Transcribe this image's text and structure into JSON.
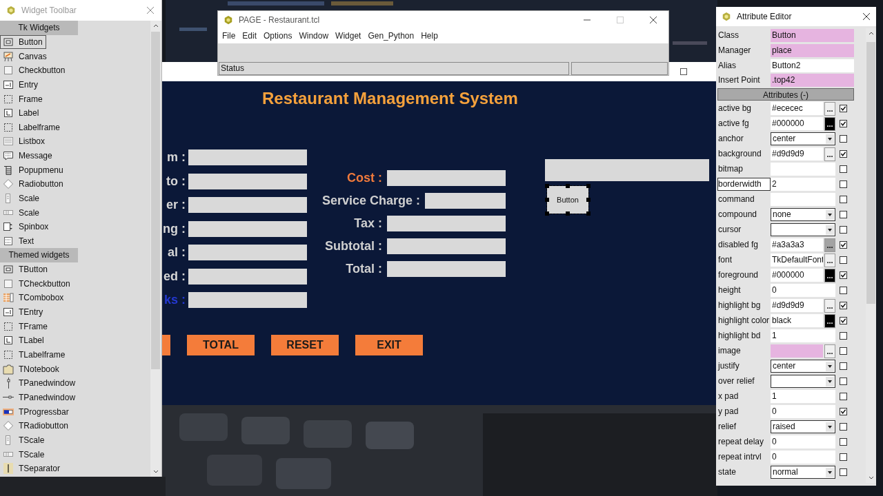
{
  "widget_toolbar": {
    "title": "Widget Toolbar",
    "sections": [
      {
        "heading": "Tk Widgets",
        "items": [
          {
            "label": "Button",
            "kind": "button",
            "selected": true
          },
          {
            "label": "Canvas",
            "kind": "canvas",
            "selected": false
          },
          {
            "label": "Checkbutton",
            "kind": "check",
            "selected": false
          },
          {
            "label": "Entry",
            "kind": "entry",
            "selected": false
          },
          {
            "label": "Frame",
            "kind": "frame",
            "selected": false
          },
          {
            "label": "Label",
            "kind": "label",
            "selected": false
          },
          {
            "label": "Labelframe",
            "kind": "frame",
            "selected": false
          },
          {
            "label": "Listbox",
            "kind": "listbox",
            "selected": false
          },
          {
            "label": "Message",
            "kind": "message",
            "selected": false
          },
          {
            "label": "Popupmenu",
            "kind": "menu",
            "selected": false
          },
          {
            "label": "Radiobutton",
            "kind": "radio",
            "selected": false
          },
          {
            "label": "Scale",
            "kind": "vscale",
            "selected": false
          },
          {
            "label": "Scale",
            "kind": "hscale",
            "selected": false
          },
          {
            "label": "Spinbox",
            "kind": "spinbox",
            "selected": false
          },
          {
            "label": "Text",
            "kind": "text",
            "selected": false
          }
        ]
      },
      {
        "heading": "Themed widgets",
        "items": [
          {
            "label": "TButton",
            "kind": "button",
            "selected": false
          },
          {
            "label": "TCheckbutton",
            "kind": "check",
            "selected": false
          },
          {
            "label": "TCombobox",
            "kind": "combobox",
            "selected": false
          },
          {
            "label": "TEntry",
            "kind": "entry",
            "selected": false
          },
          {
            "label": "TFrame",
            "kind": "frame",
            "selected": false
          },
          {
            "label": "TLabel",
            "kind": "label",
            "selected": false
          },
          {
            "label": "TLabelframe",
            "kind": "frame",
            "selected": false
          },
          {
            "label": "TNotebook",
            "kind": "notebook",
            "selected": false
          },
          {
            "label": "TPanedwindow",
            "kind": "vpane",
            "selected": false
          },
          {
            "label": "TPanedwindow",
            "kind": "hpane",
            "selected": false
          },
          {
            "label": "TProgressbar",
            "kind": "progress",
            "selected": false
          },
          {
            "label": "TRadiobutton",
            "kind": "radio",
            "selected": false
          },
          {
            "label": "TScale",
            "kind": "vscale",
            "selected": false
          },
          {
            "label": "TScale",
            "kind": "hscale",
            "selected": false
          },
          {
            "label": "TSeparator",
            "kind": "separator",
            "selected": false
          }
        ]
      }
    ]
  },
  "page_window": {
    "title": "PAGE - Restaurant.tcl",
    "menu": [
      "File",
      "Edit",
      "Options",
      "Window",
      "Widget",
      "Gen_Python",
      "Help"
    ],
    "status": "Status"
  },
  "design_window": {
    "heading": "Restaurant Management System",
    "left_rows": [
      {
        "label": "m :",
        "color": "#d6d6d6"
      },
      {
        "label": "to :",
        "color": "#d6d6d6"
      },
      {
        "label": "er :",
        "color": "#d6d6d6"
      },
      {
        "label": "ng :",
        "color": "#d6d6d6"
      },
      {
        "label": "al :",
        "color": "#d6d6d6"
      },
      {
        "label": "ed :",
        "color": "#d6d6d6"
      },
      {
        "label": "ks :",
        "color": "#2438d0"
      }
    ],
    "middle_rows": [
      {
        "label": "Cost :",
        "color": "#f07a3c"
      },
      {
        "label": "Service Charge :",
        "color": "#d0d0d0"
      },
      {
        "label": "Tax :",
        "color": "#d0d0d0"
      },
      {
        "label": "Subtotal :",
        "color": "#d0d0d0"
      },
      {
        "label": "Total :",
        "color": "#d0d0d0"
      }
    ],
    "preview_button": {
      "label": "Button",
      "selected": true
    },
    "buttons": [
      "TOTAL",
      "RESET",
      "EXIT"
    ]
  },
  "attribute_editor": {
    "title": "Attribute Editor",
    "properties": [
      {
        "name": "Class",
        "value": "Button",
        "readonly": true
      },
      {
        "name": "Manager",
        "value": "place",
        "readonly": true
      },
      {
        "name": "Alias",
        "value": "Button2",
        "readonly": false
      },
      {
        "name": "Insert Point",
        "value": ".top42",
        "readonly": true
      }
    ],
    "section": "Attributes (-)",
    "attributes": [
      {
        "name": "active bg",
        "kind": "picker",
        "value": "#ececec",
        "button": {
          "label": "...",
          "color": "#f0f0f0"
        },
        "checked": true,
        "readonly": false,
        "focused": false
      },
      {
        "name": "active fg",
        "kind": "picker",
        "value": "#000000",
        "button": {
          "label": "...",
          "color": "#000000"
        },
        "checked": true,
        "readonly": false,
        "focused": false
      },
      {
        "name": "anchor",
        "kind": "combo",
        "value": "center",
        "checked": false,
        "readonly": false,
        "focused": false
      },
      {
        "name": "background",
        "kind": "picker",
        "value": "#d9d9d9",
        "button": {
          "label": "...",
          "color": "#f0f0f0"
        },
        "checked": true,
        "readonly": false,
        "focused": false
      },
      {
        "name": "bitmap",
        "kind": "entry",
        "checked": false,
        "readonly": false,
        "focused": false
      },
      {
        "name": "borderwidth",
        "kind": "entry",
        "value": "2",
        "checked": false,
        "readonly": false,
        "focused": true
      },
      {
        "name": "command",
        "kind": "entry",
        "checked": false,
        "readonly": false,
        "focused": false
      },
      {
        "name": "compound",
        "kind": "combo",
        "value": "none",
        "checked": false,
        "readonly": false,
        "focused": false
      },
      {
        "name": "cursor",
        "kind": "combo",
        "checked": false,
        "readonly": false,
        "focused": false
      },
      {
        "name": "disabled fg",
        "kind": "picker",
        "value": "#a3a3a3",
        "button": {
          "label": "...",
          "color": "#a3a3a3"
        },
        "checked": true,
        "readonly": false,
        "focused": false
      },
      {
        "name": "font",
        "kind": "picker",
        "value": "TkDefaultFont",
        "button": {
          "label": "...",
          "color": "#f0f0f0"
        },
        "checked": false,
        "readonly": false,
        "focused": false
      },
      {
        "name": "foreground",
        "kind": "picker",
        "value": "#000000",
        "button": {
          "label": "...",
          "color": "#000000"
        },
        "checked": true,
        "readonly": false,
        "focused": false
      },
      {
        "name": "height",
        "kind": "entry",
        "value": "0",
        "checked": false,
        "readonly": false,
        "focused": false
      },
      {
        "name": "highlight bg",
        "kind": "picker",
        "value": "#d9d9d9",
        "button": {
          "label": "...",
          "color": "#f0f0f0"
        },
        "checked": true,
        "readonly": false,
        "focused": false
      },
      {
        "name": "highlight color",
        "kind": "picker",
        "value": "black",
        "button": {
          "label": "...",
          "color": "#000000"
        },
        "checked": true,
        "readonly": false,
        "focused": false
      },
      {
        "name": "highlight bd",
        "kind": "entry",
        "value": "1",
        "checked": false,
        "readonly": false,
        "focused": false
      },
      {
        "name": "image",
        "kind": "picker",
        "button": {
          "label": "...",
          "color": "#f0f0f0"
        },
        "checked": false,
        "readonly": true,
        "focused": false
      },
      {
        "name": "justify",
        "kind": "combo",
        "value": "center",
        "checked": false,
        "readonly": false,
        "focused": false
      },
      {
        "name": "over relief",
        "kind": "combo",
        "checked": false,
        "readonly": false,
        "focused": false
      },
      {
        "name": "x pad",
        "kind": "entry",
        "value": "1",
        "checked": false,
        "readonly": false,
        "focused": false
      },
      {
        "name": "y pad",
        "kind": "entry",
        "value": "0",
        "checked": true,
        "readonly": false,
        "focused": false
      },
      {
        "name": "relief",
        "kind": "combo",
        "value": "raised",
        "checked": false,
        "readonly": false,
        "focused": false
      },
      {
        "name": "repeat delay",
        "kind": "entry",
        "value": "0",
        "checked": false,
        "readonly": false,
        "focused": false
      },
      {
        "name": "repeat intrvl",
        "kind": "entry",
        "value": "0",
        "checked": false,
        "readonly": false,
        "focused": false
      },
      {
        "name": "state",
        "kind": "combo",
        "value": "normal",
        "checked": false,
        "readonly": false,
        "focused": false
      }
    ]
  }
}
